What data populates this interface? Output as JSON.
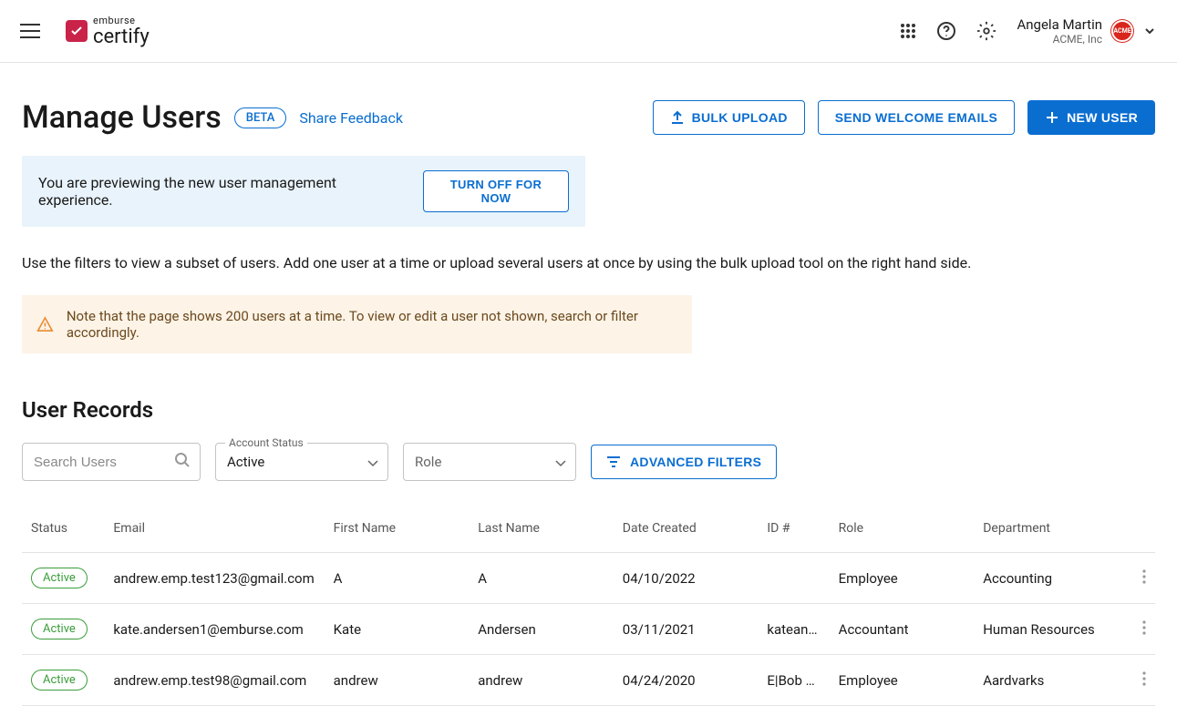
{
  "header": {
    "logo_top": "emburse",
    "logo_bottom": "certify",
    "user_name": "Angela Martin",
    "user_company": "ACME, Inc",
    "avatar_text": "ACME"
  },
  "page": {
    "title": "Manage Users",
    "beta": "BETA",
    "feedback": "Share Feedback",
    "actions": {
      "bulk_upload": "BULK UPLOAD",
      "welcome_emails": "SEND WELCOME EMAILS",
      "new_user": "NEW USER"
    },
    "preview_banner": "You are previewing the new user management experience.",
    "turnoff": "TURN OFF FOR NOW",
    "helper": "Use the filters to view a subset of users. Add one user at a time or upload several users at once by using the bulk upload tool on the right hand side.",
    "warn": "Note that the page shows 200 users at a time. To view or edit a user not shown, search or filter accordingly."
  },
  "records": {
    "section_title": "User Records",
    "search_placeholder": "Search Users",
    "account_status_label": "Account Status",
    "account_status_value": "Active",
    "role_placeholder": "Role",
    "advanced_filters": "ADVANCED FILTERS",
    "columns": {
      "status": "Status",
      "email": "Email",
      "first": "First Name",
      "last": "Last Name",
      "date": "Date Created",
      "id": "ID #",
      "role": "Role",
      "dept": "Department"
    },
    "rows": [
      {
        "status": "Active",
        "email": "andrew.emp.test123@gmail.com",
        "first": "A",
        "last": "A",
        "date": "04/10/2022",
        "id": "",
        "role": "Employee",
        "dept": "Accounting"
      },
      {
        "status": "Active",
        "email": "kate.andersen1@emburse.com",
        "first": "Kate",
        "last": "Andersen",
        "date": "03/11/2021",
        "id": "katean…",
        "role": "Accountant",
        "dept": "Human Resources"
      },
      {
        "status": "Active",
        "email": "andrew.emp.test98@gmail.com",
        "first": "andrew",
        "last": "andrew",
        "date": "04/24/2020",
        "id": "E|Bob …",
        "role": "Employee",
        "dept": "Aardvarks"
      }
    ]
  }
}
